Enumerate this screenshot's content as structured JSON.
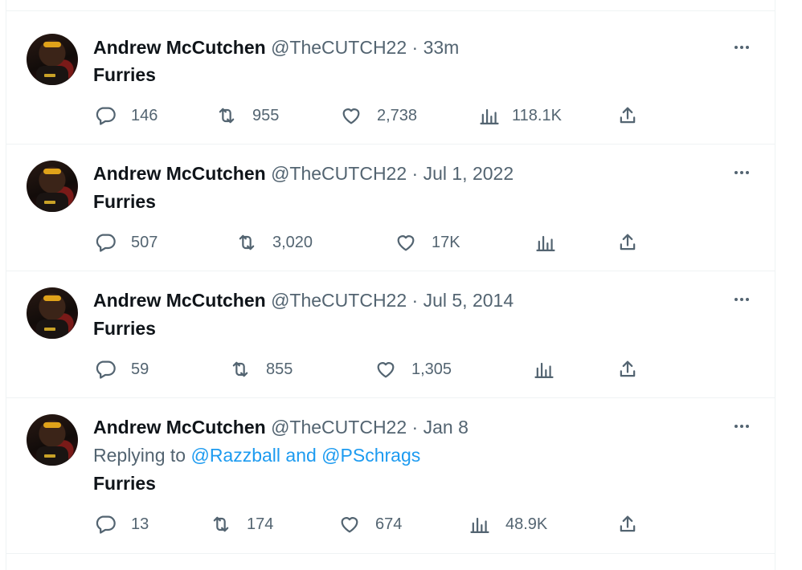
{
  "tweets": [
    {
      "name": "Andrew McCutchen",
      "handle": "@TheCUTCH22",
      "separator": "·",
      "time": "33m",
      "text": "Furries",
      "replies": "146",
      "retweets": "955",
      "likes": "2,738",
      "views": "118.1K"
    },
    {
      "name": "Andrew McCutchen",
      "handle": "@TheCUTCH22",
      "separator": "·",
      "time": "Jul 1, 2022",
      "text": "Furries",
      "replies": "507",
      "retweets": "3,020",
      "likes": "17K",
      "views": ""
    },
    {
      "name": "Andrew McCutchen",
      "handle": "@TheCUTCH22",
      "separator": "·",
      "time": "Jul 5, 2014",
      "text": "Furries",
      "replies": "59",
      "retweets": "855",
      "likes": "1,305",
      "views": ""
    },
    {
      "name": "Andrew McCutchen",
      "handle": "@TheCUTCH22",
      "separator": "·",
      "time": "Jan 8",
      "replying_prefix": "Replying to",
      "replying_mentions": "@Razzball and @PSchrags",
      "text": "Furries",
      "replies": "13",
      "retweets": "174",
      "likes": "674",
      "views": "48.9K"
    }
  ],
  "colors": {
    "text_primary": "#0f1419",
    "text_secondary": "#536471",
    "link": "#1d9bf0",
    "divider": "#eff3f4"
  },
  "icons": [
    "reply-icon",
    "retweet-icon",
    "like-icon",
    "views-icon",
    "share-icon",
    "more-icon"
  ]
}
